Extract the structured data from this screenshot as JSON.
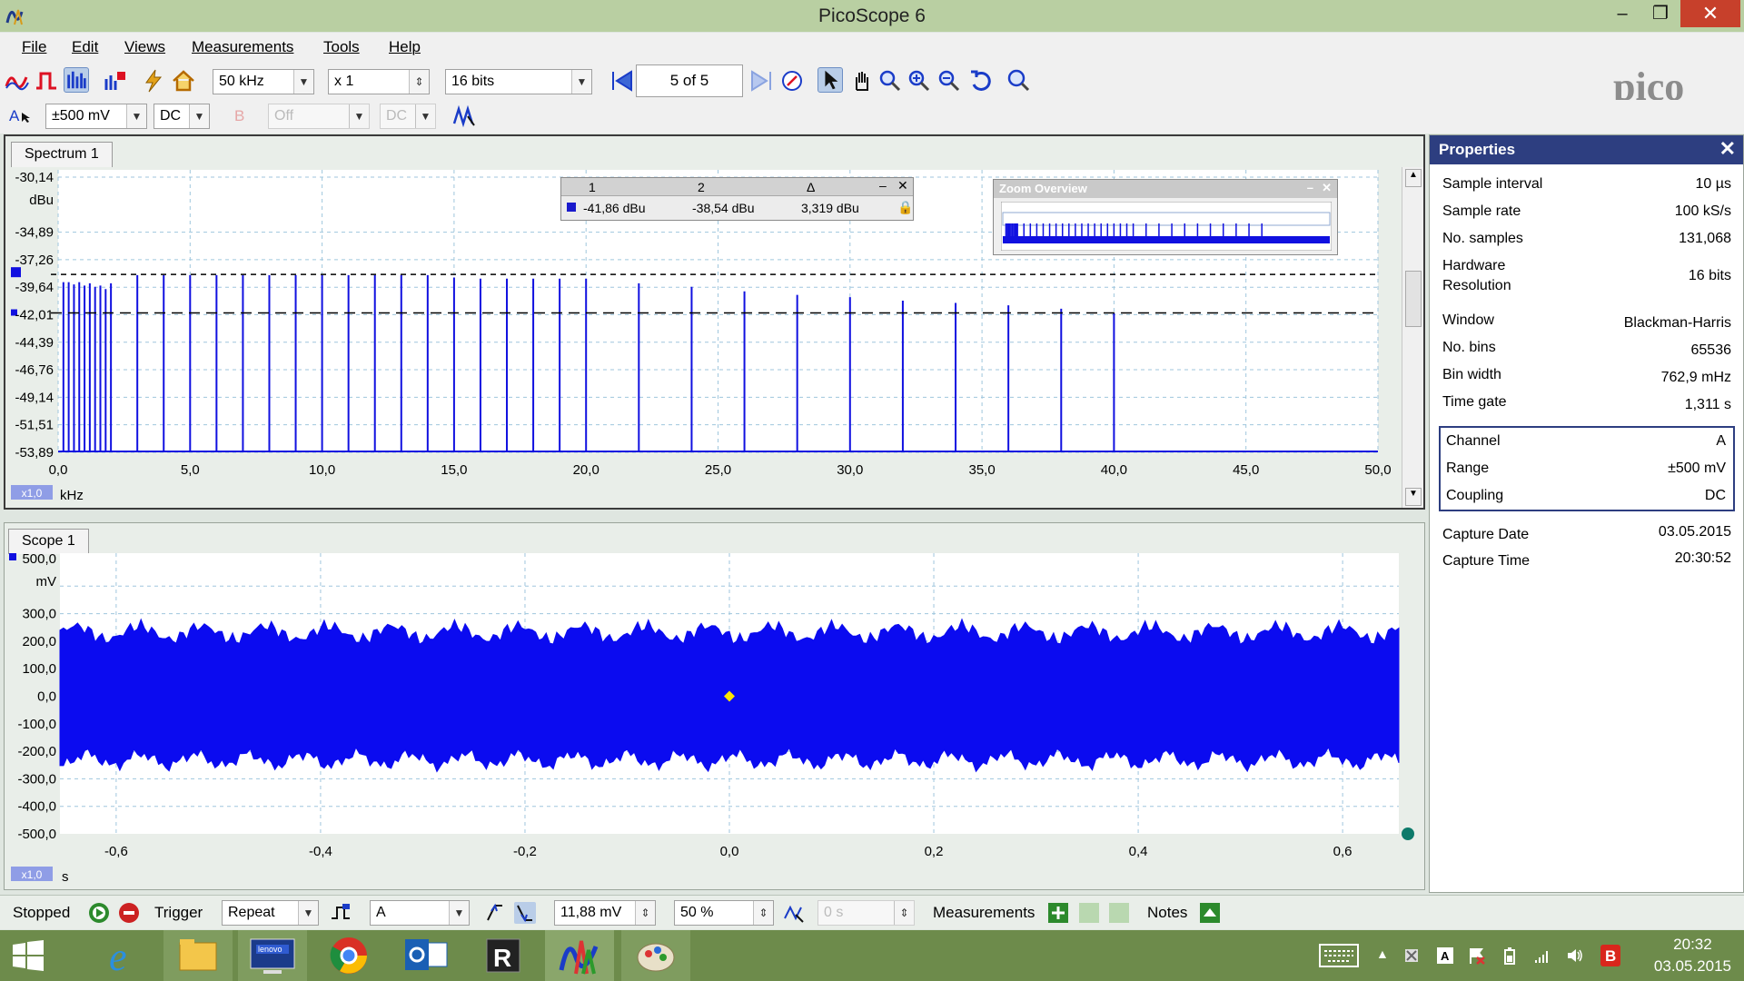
{
  "window": {
    "title": "PicoScope 6",
    "minimize": "–",
    "maximize": "❐",
    "close": "✕"
  },
  "menu": [
    "File",
    "Edit",
    "Views",
    "Measurements",
    "Tools",
    "Help"
  ],
  "toolbar": {
    "timebase": "50 kHz",
    "multiplier": "x 1",
    "resolution": "16 bits",
    "buffer": "5 of 5"
  },
  "channels": {
    "a_label": "A",
    "a_range": "±500 mV",
    "a_coupling": "DC",
    "b_label": "B",
    "b_range": "Off",
    "b_coupling": "DC"
  },
  "spectrum": {
    "tab": "Spectrum 1",
    "y_unit": "dBu",
    "x_unit": "kHz",
    "zoom_badge": "x1,0",
    "y_ticks": [
      "-30,14",
      "-34,89",
      "-37,26",
      "-39,64",
      "-42,01",
      "-44,39",
      "-46,76",
      "-49,14",
      "-51,51",
      "-53,89"
    ],
    "x_ticks": [
      "0,0",
      "5,0",
      "10,0",
      "15,0",
      "20,0",
      "25,0",
      "30,0",
      "35,0",
      "40,0",
      "45,0",
      "50,0"
    ],
    "rulers": {
      "header_1": "1",
      "header_2": "2",
      "header_delta": "Δ",
      "value_1": "-41,86 dBu",
      "value_2": "-38,54 dBu",
      "value_delta": "3,319 dBu"
    },
    "zoom_overview": "Zoom Overview"
  },
  "chart_data": {
    "type": "bar",
    "x_unit": "kHz",
    "y_unit": "dBu",
    "xlim": [
      0,
      50
    ],
    "ylim": [
      -53.89,
      -30.14
    ],
    "ruler_levels": [
      -38.54,
      -41.86
    ],
    "peaks_x_khz": [
      0.2,
      0.4,
      0.6,
      0.8,
      1.0,
      1.2,
      1.4,
      1.6,
      1.8,
      2.0,
      3.0,
      4.0,
      5.0,
      6.0,
      7.0,
      8.0,
      9.0,
      10.0,
      11.0,
      12.0,
      13.0,
      14.0,
      15.0,
      16.0,
      17.0,
      18.0,
      19.0,
      20.0,
      22.0,
      24.0,
      26.0,
      28.0,
      30.0,
      32.0,
      34.0,
      36.0,
      38.0,
      40.0
    ],
    "peaks_top_dbu": [
      -39.2,
      -39.2,
      -39.4,
      -39.2,
      -39.5,
      -39.3,
      -39.6,
      -39.5,
      -39.8,
      -39.3,
      -38.6,
      -38.6,
      -38.6,
      -38.6,
      -38.6,
      -38.6,
      -38.6,
      -38.6,
      -38.6,
      -38.6,
      -38.6,
      -38.6,
      -38.8,
      -38.9,
      -38.9,
      -38.9,
      -38.9,
      -38.9,
      -39.3,
      -39.6,
      -40.0,
      -40.3,
      -40.5,
      -40.8,
      -41.0,
      -41.2,
      -41.5,
      -41.9
    ]
  },
  "scope": {
    "tab": "Scope 1",
    "y_unit": "mV",
    "x_unit": "s",
    "zoom_badge": "x1,0",
    "y_ticks": [
      "500,0",
      "300,0",
      "200,0",
      "100,0",
      "0,0",
      "-100,0",
      "-200,0",
      "-300,0",
      "-400,0",
      "-500,0"
    ],
    "x_ticks": [
      "-0,6",
      "-0,4",
      "-0,2",
      "0,0",
      "0,2",
      "0,4",
      "0,6"
    ]
  },
  "properties": {
    "title": "Properties",
    "rows": [
      {
        "k": "Sample interval",
        "v": "10 µs"
      },
      {
        "k": "Sample rate",
        "v": "100 kS/s"
      },
      {
        "k": "No. samples",
        "v": "131,068"
      },
      {
        "k": "Hardware",
        "k2": "Resolution",
        "v": "16 bits"
      },
      {
        "k": "Window",
        "v": "Blackman-Harris"
      },
      {
        "k": "No. bins",
        "v": "65536"
      },
      {
        "k": "Bin width",
        "v": "762,9 mHz"
      },
      {
        "k": "Time gate",
        "v": "1,311 s"
      }
    ],
    "channel": [
      {
        "k": "Channel",
        "v": "A"
      },
      {
        "k": "Range",
        "v": "±500 mV"
      },
      {
        "k": "Coupling",
        "v": "DC"
      }
    ],
    "capture": [
      {
        "k": "Capture Date",
        "v": "03.05.2015"
      },
      {
        "k": "Capture Time",
        "v": "20:30:52"
      }
    ]
  },
  "status": {
    "state": "Stopped",
    "trigger_label": "Trigger",
    "trigger_mode": "Repeat",
    "trigger_channel": "A",
    "threshold": "11,88 mV",
    "pre_trigger": "50 %",
    "delay": "0 s",
    "measurements": "Measurements",
    "notes": "Notes"
  },
  "taskbar": {
    "time": "20:32",
    "date": "03.05.2015",
    "lenovo": "lenovo",
    "b_badge": "B",
    "a_badge": "A"
  }
}
